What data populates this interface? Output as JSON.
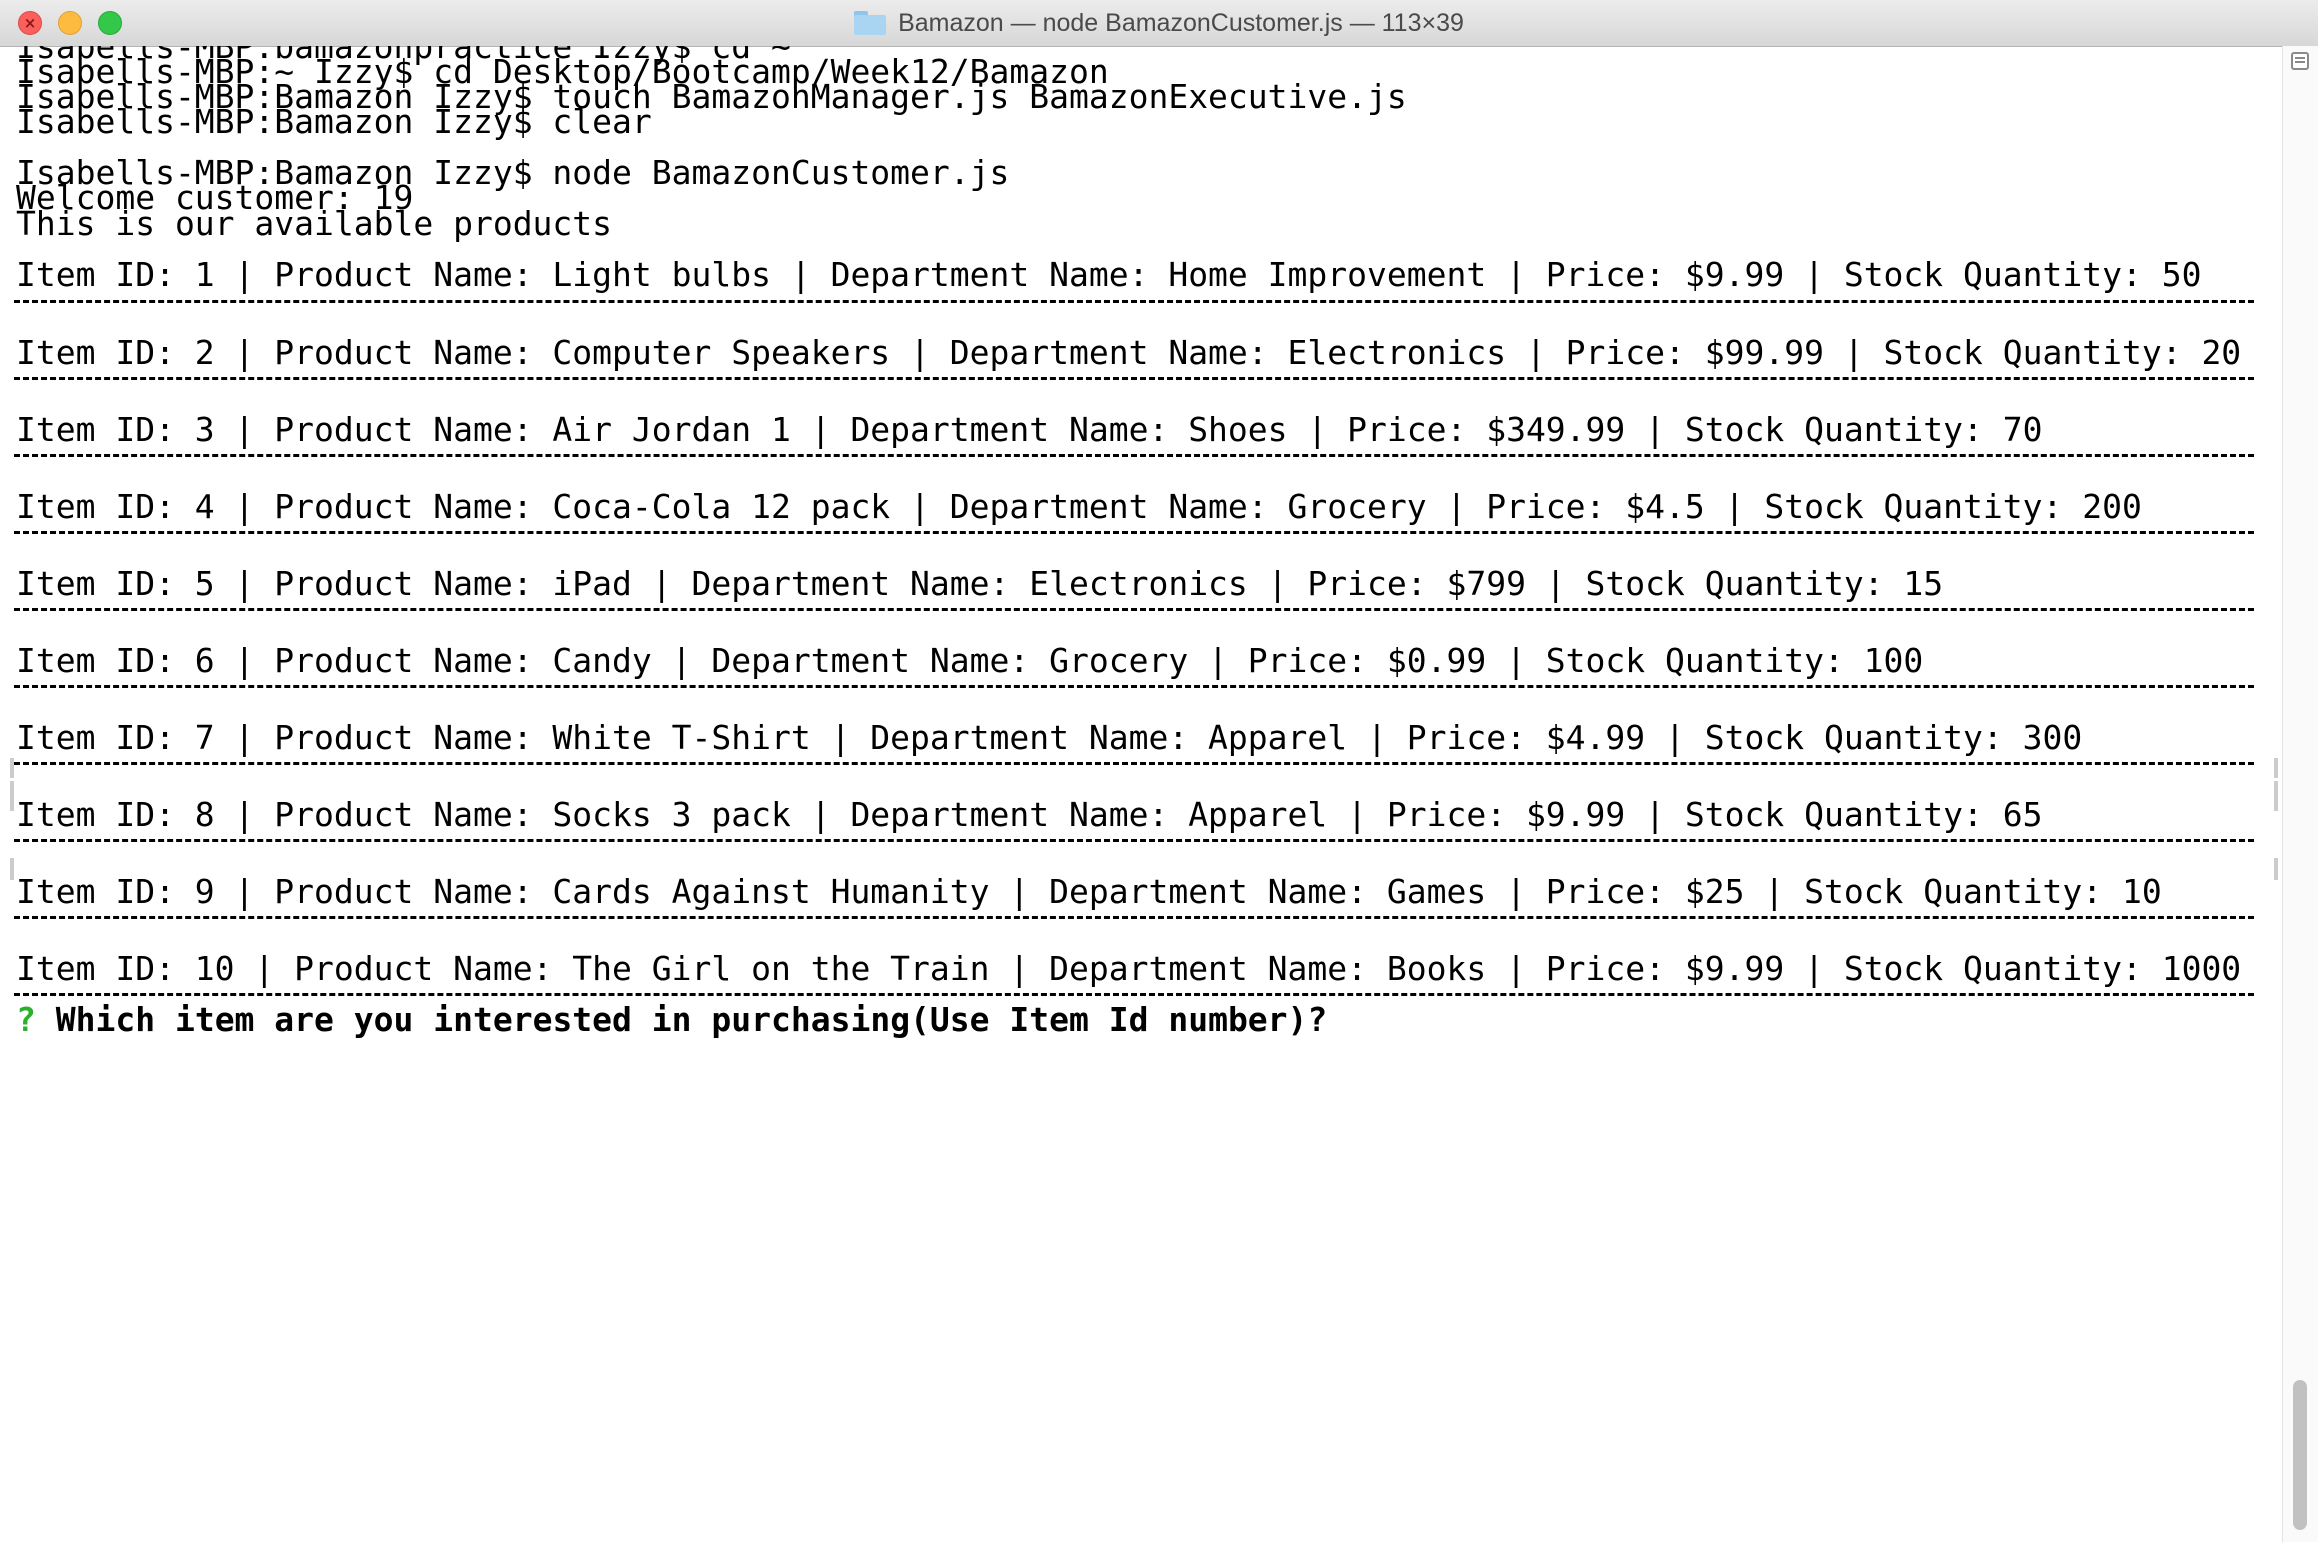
{
  "window": {
    "title": "Bamazon — node BamazonCustomer.js — 113×39",
    "folder_icon": "folder-icon",
    "close_glyph": "×"
  },
  "terminal": {
    "history": [
      "Isabells-MBP:bamazonpractice Izzy$ cd ~",
      "Isabells-MBP:~ Izzy$ cd Desktop/Bootcamp/Week12/Bamazon",
      "Isabells-MBP:Bamazon Izzy$ touch BamazonManager.js BamazonExecutive.js",
      "Isabells-MBP:Bamazon Izzy$ clear",
      "Isabells-MBP:Bamazon Izzy$ node BamazonCustomer.js",
      "Welcome customer: 19",
      "This is our available products"
    ],
    "products": [
      "Item ID: 1 | Product Name: Light bulbs | Department Name: Home Improvement | Price: $9.99 | Stock Quantity: 50",
      "Item ID: 2 | Product Name: Computer Speakers | Department Name: Electronics | Price: $99.99 | Stock Quantity: 20",
      "Item ID: 3 | Product Name: Air Jordan 1 | Department Name: Shoes | Price: $349.99 | Stock Quantity: 70",
      "Item ID: 4 | Product Name: Coca-Cola 12 pack | Department Name: Grocery | Price: $4.5 | Stock Quantity: 200",
      "Item ID: 5 | Product Name: iPad | Department Name: Electronics | Price: $799 | Stock Quantity: 15",
      "Item ID: 6 | Product Name: Candy | Department Name: Grocery | Price: $0.99 | Stock Quantity: 100",
      "Item ID: 7 | Product Name: White T-Shirt | Department Name: Apparel | Price: $4.99 | Stock Quantity: 300",
      "Item ID: 8 | Product Name: Socks 3 pack | Department Name: Apparel | Price: $9.99 | Stock Quantity: 65",
      "Item ID: 9 | Product Name: Cards Against Humanity | Department Name: Games | Price: $25 | Stock Quantity: 10",
      "Item ID: 10 | Product Name: The Girl on the Train | Department Name: Books | Price: $9.99 | Stock Quantity: 1000"
    ],
    "prompt": {
      "mark": "?",
      "question": "Which item are you interested in purchasing(Use Item Id number)?"
    },
    "colors": {
      "prompt_mark": "#2cb02c",
      "text": "#000000",
      "background": "#ffffff"
    }
  }
}
